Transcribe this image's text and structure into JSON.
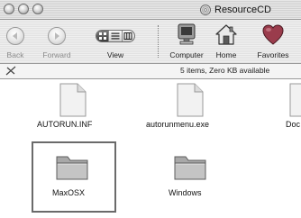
{
  "window": {
    "title": "ResourceCD",
    "title_icon": "cd-disc-icon"
  },
  "toolbar": {
    "back_label": "Back",
    "forward_label": "Forward",
    "view_label": "View",
    "view_modes": [
      "icon-view",
      "list-view",
      "column-view"
    ],
    "view_selected": "icon-view",
    "computer_label": "Computer",
    "home_label": "Home",
    "favorites_label": "Favorites"
  },
  "status": {
    "text": "5 items, Zero KB available",
    "lock_icon": "read-only-pencil-icon"
  },
  "files": [
    {
      "name": "AUTORUN.INF",
      "icon": "document-icon"
    },
    {
      "name": "autorunmenu.exe",
      "icon": "document-icon"
    },
    {
      "name": "Doc",
      "icon": "document-icon"
    },
    {
      "name": "MaxOSX",
      "icon": "folder-icon",
      "selected": true
    },
    {
      "name": "Windows",
      "icon": "folder-icon"
    }
  ],
  "colors": {
    "favorites_heart": "#9a3c4c",
    "selection_border": "#6a6a6a"
  }
}
